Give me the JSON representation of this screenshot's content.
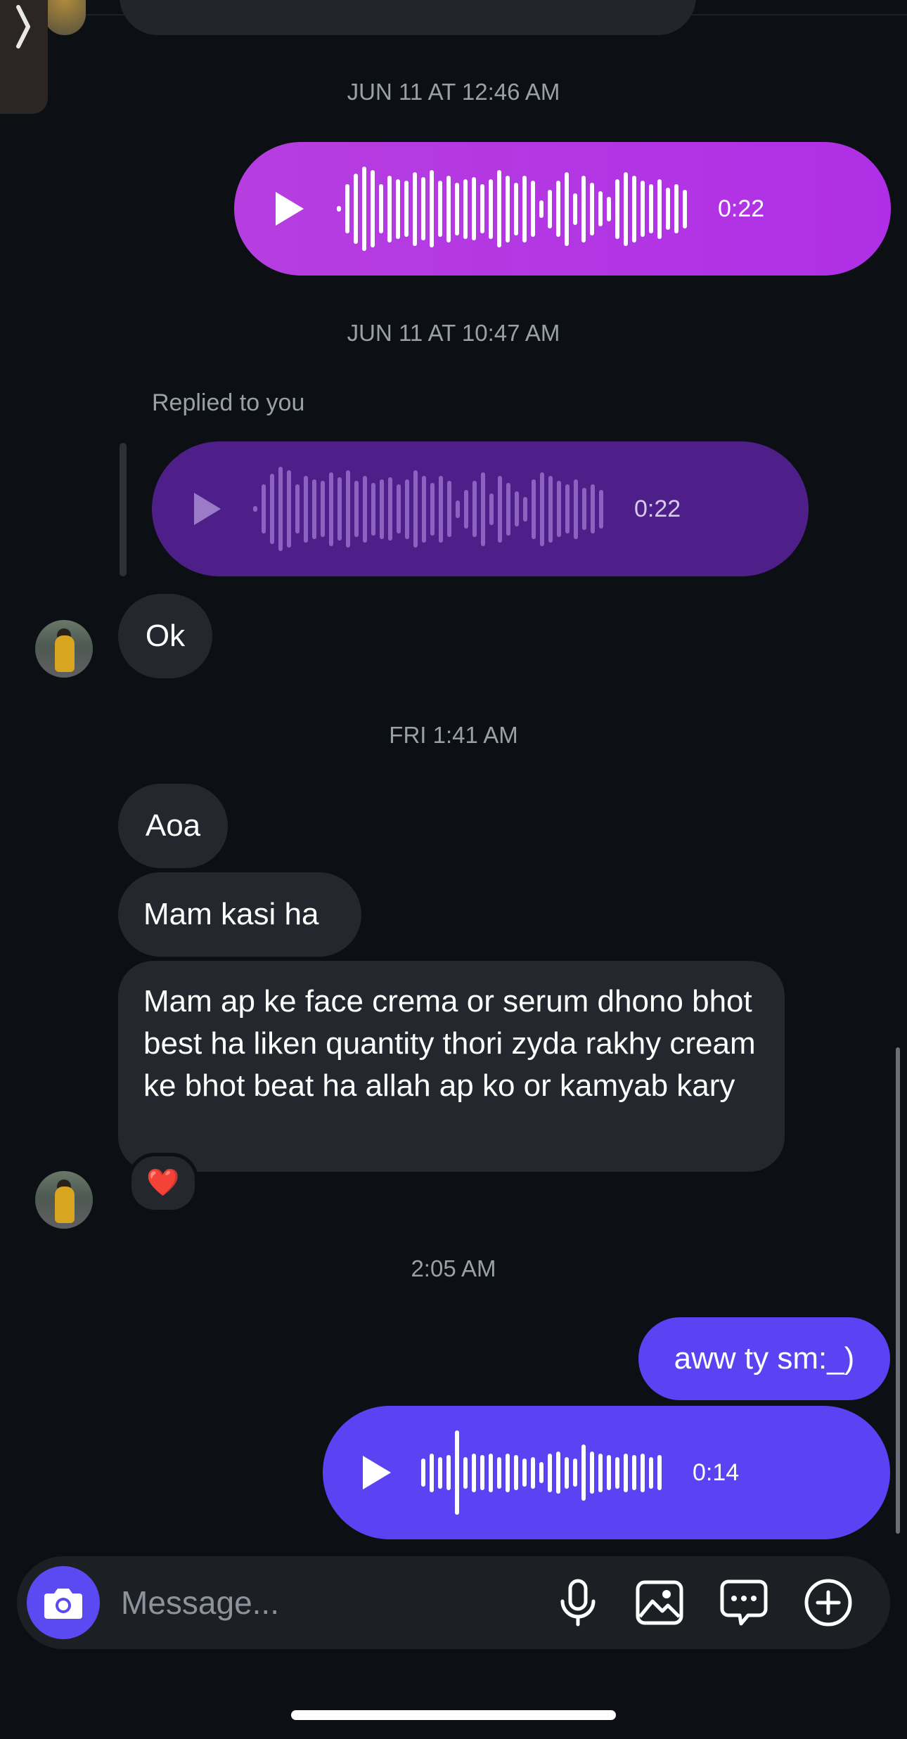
{
  "thread": {
    "timestamps": {
      "t1": "JUN 11 AT 12:46 AM",
      "t2": "JUN 11 AT 10:47 AM",
      "t3": "FRI 1:41 AM",
      "t4": "2:05 AM"
    },
    "voice_messages": [
      {
        "duration": "0:22",
        "color": "#b535e0"
      },
      {
        "duration": "0:22",
        "color": "#4e1f88"
      },
      {
        "duration": "0:14",
        "color": "#5b42f3"
      }
    ],
    "reply_label": "Replied to you",
    "messages": {
      "ok": "Ok",
      "aoa": "Aoa",
      "mam_kasi": "Mam kasi ha",
      "long": "Mam ap ke face crema or serum dhono bhot best ha liken quantity thori zyda rakhy cream ke bhot beat ha allah ap ko or kamyab kary",
      "aww": "aww ty sm:_)"
    },
    "reaction": "❤️"
  },
  "composer": {
    "placeholder": "Message...",
    "icons": [
      "camera-icon",
      "microphone-icon",
      "image-icon",
      "sticker-chat-icon",
      "plus-circle-icon"
    ]
  },
  "colors": {
    "background": "#0c0f14",
    "incoming_bubble": "#24272d",
    "outgoing_accent": "#5b42f3",
    "voice_magenta": "#b535e0",
    "voice_reply_purple": "#4e1f88"
  }
}
